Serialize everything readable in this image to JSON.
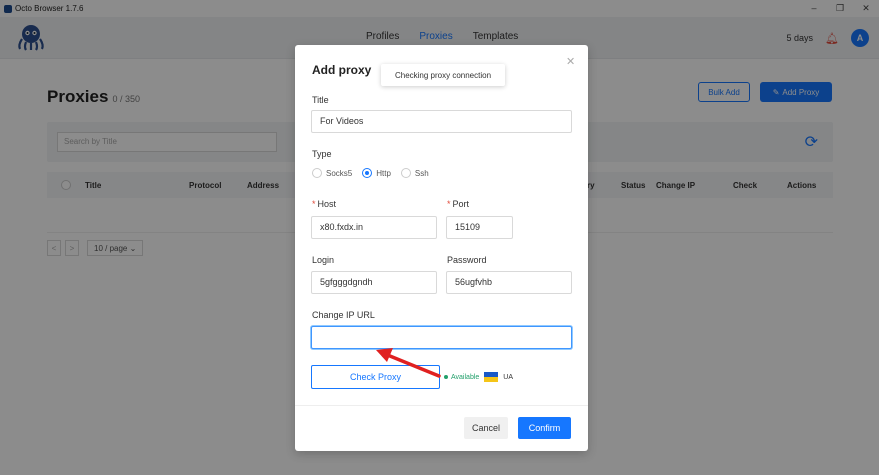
{
  "window": {
    "title": "Octo Browser 1.7.6",
    "minimize": "–",
    "restore": "❐",
    "close": "✕"
  },
  "nav": {
    "profiles": "Profiles",
    "proxies": "Proxies",
    "templates": "Templates"
  },
  "header": {
    "days": "5 days",
    "avatar_letter": "A"
  },
  "page": {
    "title": "Proxies",
    "count": "0 / 350",
    "bulk_add": "Bulk Add",
    "add_proxy": "Add Proxy",
    "search_placeholder": "Search by Title",
    "columns": [
      "Title",
      "Protocol",
      "Address",
      "ry",
      "Status",
      "Change IP",
      "Check",
      "Actions"
    ],
    "page_size": "10 / page"
  },
  "modal": {
    "title": "Add proxy",
    "tooltip": "Checking proxy connection",
    "title_label": "Title",
    "title_value": "For Videos",
    "type_label": "Type",
    "types": [
      "Socks5",
      "Http",
      "Ssh"
    ],
    "selected_type": "Http",
    "host_label": "Host",
    "host_value": "x80.fxdx.in",
    "port_label": "Port",
    "port_value": "15109",
    "login_label": "Login",
    "login_value": "5gfgggdgndh",
    "password_label": "Password",
    "password_value": "56ugfvhb",
    "change_ip_label": "Change IP URL",
    "change_ip_value": "",
    "check_proxy": "Check Proxy",
    "status": "Available",
    "country": "UA",
    "cancel": "Cancel",
    "confirm": "Confirm"
  },
  "colors": {
    "accent": "#1677ff",
    "available": "#22a06b",
    "flag_blue": "#1959c8",
    "flag_yellow": "#f5c518",
    "arrow": "#e02020"
  }
}
